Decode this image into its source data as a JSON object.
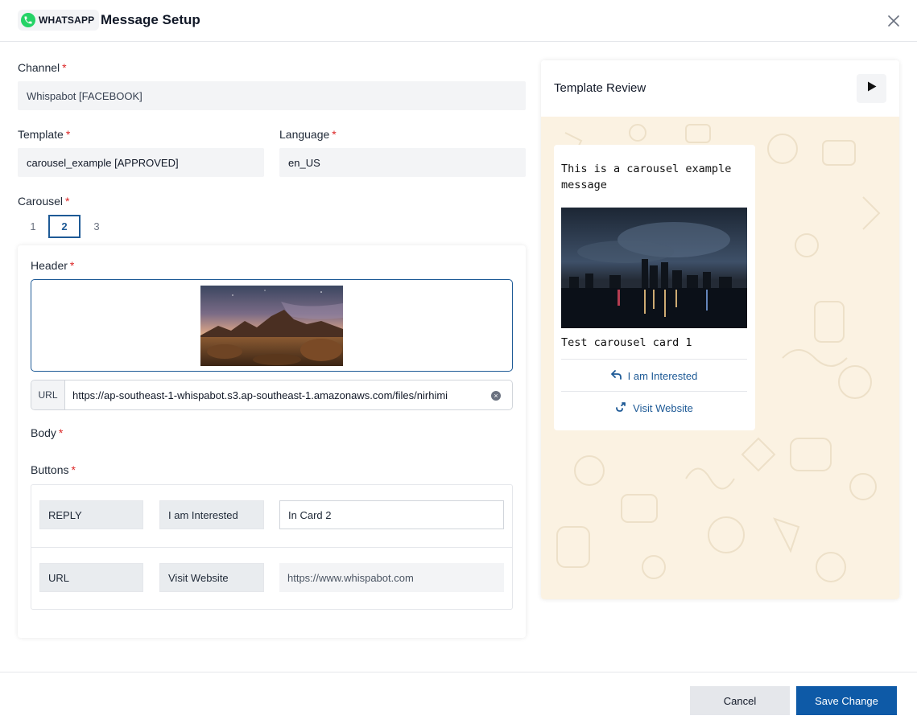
{
  "header": {
    "badge_text": "WHATSAPP",
    "title": "Message Setup",
    "close_icon": "close-icon"
  },
  "form": {
    "channel": {
      "label": "Channel",
      "required": "*",
      "value": "Whispabot [FACEBOOK]"
    },
    "template": {
      "label": "Template",
      "required": "*",
      "value": "carousel_example [APPROVED]"
    },
    "language": {
      "label": "Language",
      "required": "*",
      "value": "en_US"
    },
    "carousel": {
      "label": "Carousel",
      "required": "*",
      "tabs": [
        "1",
        "2",
        "3"
      ],
      "active": "2"
    },
    "card": {
      "header_label": "Header",
      "header_required": "*",
      "url_tag": "URL",
      "url_value": "https://ap-southeast-1-whispabot.s3.ap-southeast-1.amazonaws.com/files/nirhimi",
      "body_label": "Body",
      "body_required": "*",
      "buttons_label": "Buttons",
      "buttons_required": "*",
      "buttons": [
        {
          "type": "REPLY",
          "text": "I am Interested",
          "value": "In Card 2"
        },
        {
          "type": "URL",
          "text": "Visit Website",
          "value": "https://www.whispabot.com"
        }
      ]
    }
  },
  "preview": {
    "title": "Template Review",
    "message": "This is a carousel example message",
    "card_caption": "Test carousel card 1",
    "buttons": [
      {
        "label": "I am Interested",
        "icon": "reply-icon"
      },
      {
        "label": "Visit Website",
        "icon": "external-link-icon"
      }
    ]
  },
  "footer": {
    "cancel_label": "Cancel",
    "save_label": "Save Change"
  },
  "colors": {
    "primary": "#0e5aa7",
    "accent_border": "#1e5a96",
    "required": "#dc2626",
    "whatsapp_green": "#25d366",
    "chat_bg": "#fbf2e2"
  }
}
